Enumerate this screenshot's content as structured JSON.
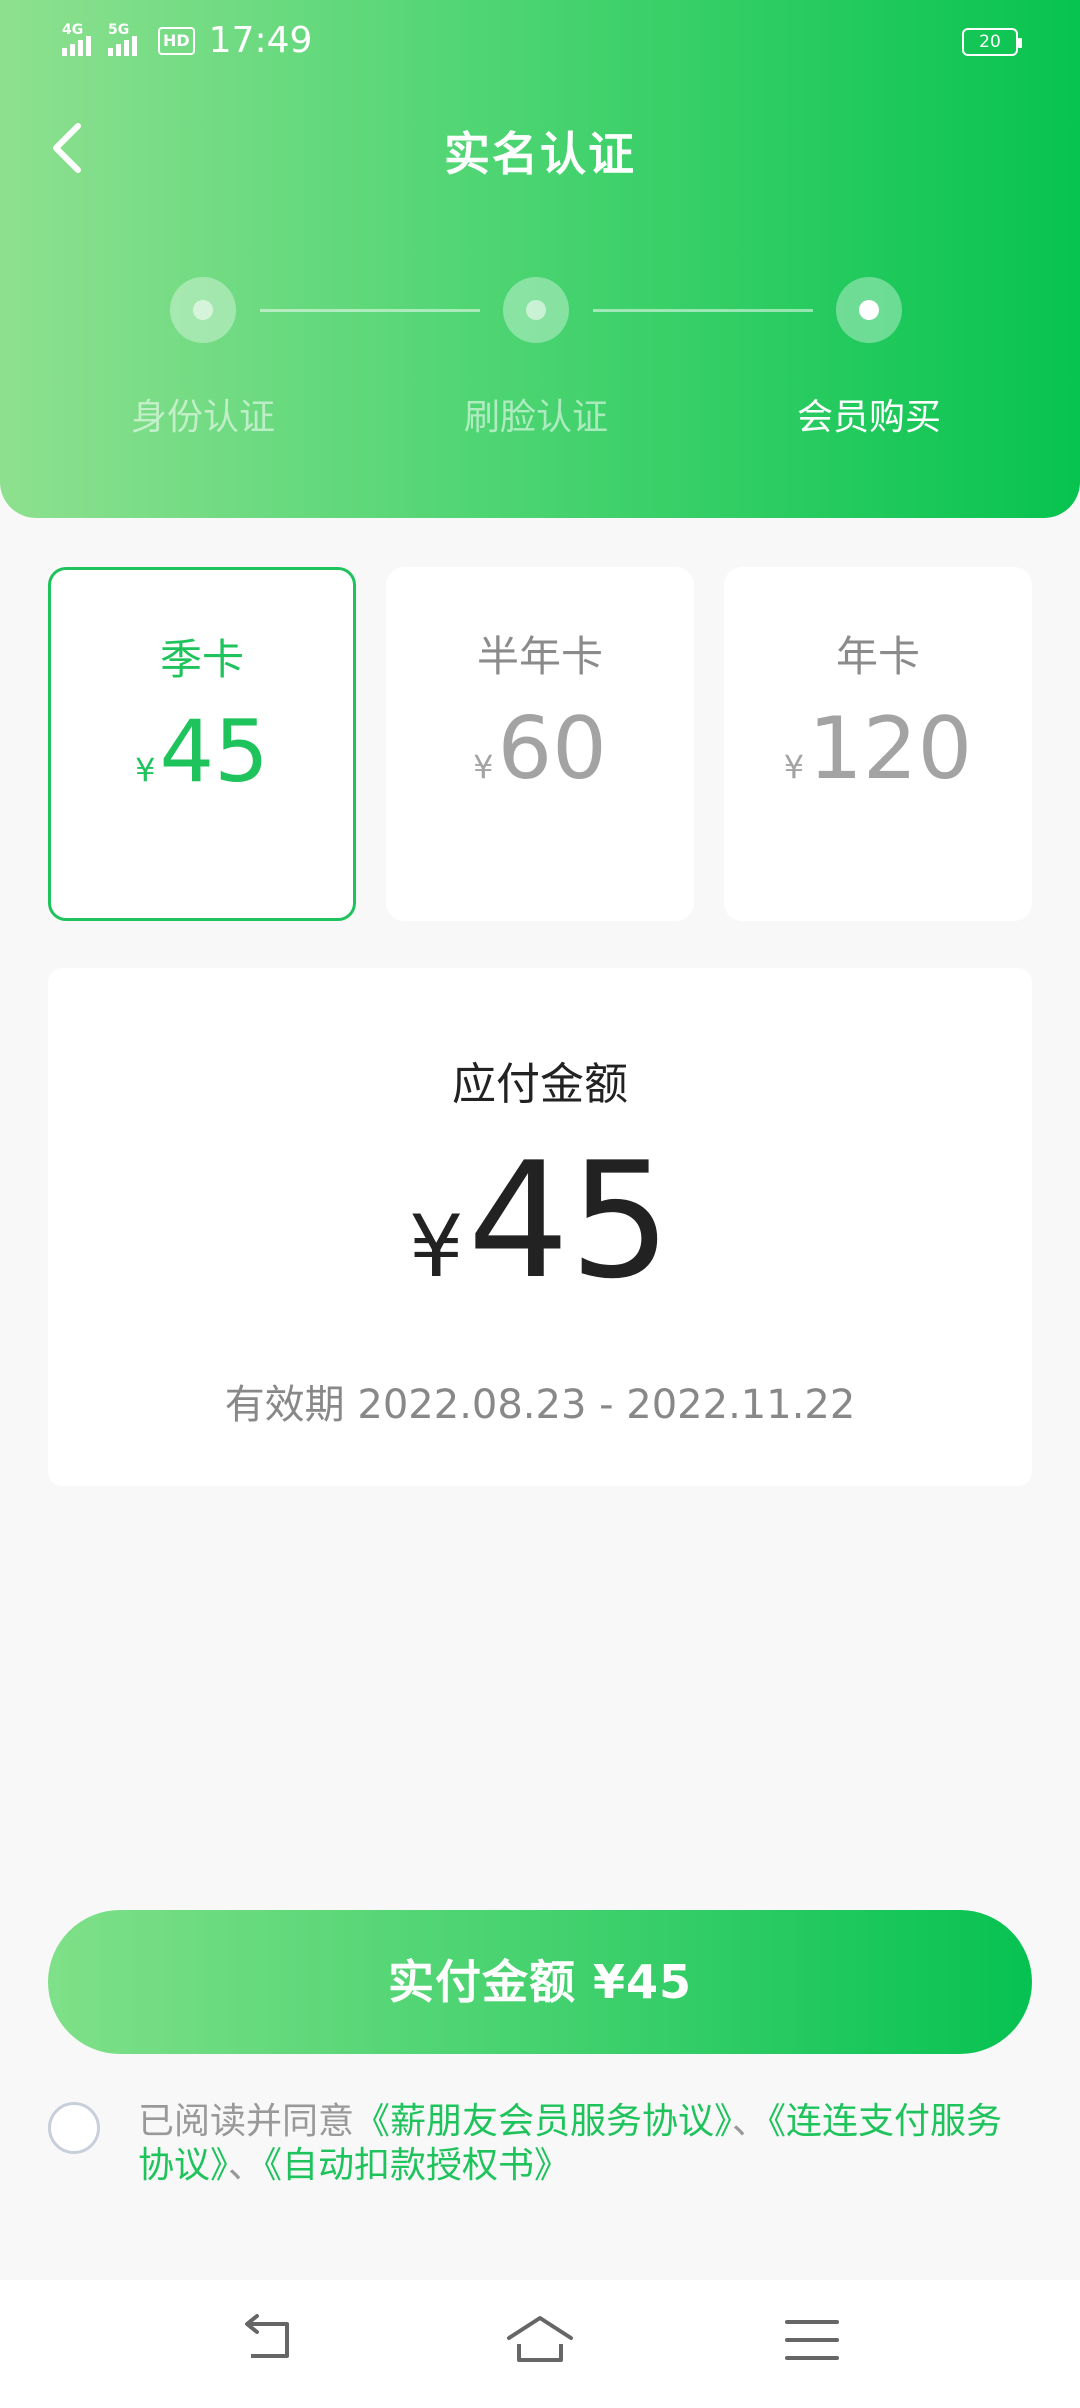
{
  "status_bar": {
    "net1": "4G",
    "net2": "5G",
    "hd": "HD",
    "time": "17:49",
    "battery": "20"
  },
  "header": {
    "title": "实名认证",
    "back_icon": "chevron-left-icon",
    "steps": [
      {
        "label": "身份认证",
        "active": false
      },
      {
        "label": "刷脸认证",
        "active": false
      },
      {
        "label": "会员购买",
        "active": true
      }
    ]
  },
  "plans": [
    {
      "name": "季卡",
      "currency": "¥",
      "price": "45",
      "selected": true
    },
    {
      "name": "半年卡",
      "currency": "¥",
      "price": "60",
      "selected": false
    },
    {
      "name": "年卡",
      "currency": "¥",
      "price": "120",
      "selected": false
    }
  ],
  "payment": {
    "title": "应付金额",
    "currency": "¥",
    "amount": "45",
    "validity": "有效期 2022.08.23 - 2022.11.22"
  },
  "pay_button": {
    "label": "实付金额 ¥45"
  },
  "agreement": {
    "prefix": "已阅读并同意",
    "link1": "《薪朋友会员服务协议》",
    "sep1": "、",
    "link2": "《连连支付服务协议》",
    "sep2": "、",
    "link3": "《自动扣款授权书》",
    "checked": false
  },
  "colors": {
    "accent": "#1fc35c",
    "header_gradient_start": "#8ee08f",
    "header_gradient_end": "#07c34f"
  },
  "navbar": {
    "icons": [
      "back-icon",
      "home-icon",
      "menu-icon"
    ]
  }
}
